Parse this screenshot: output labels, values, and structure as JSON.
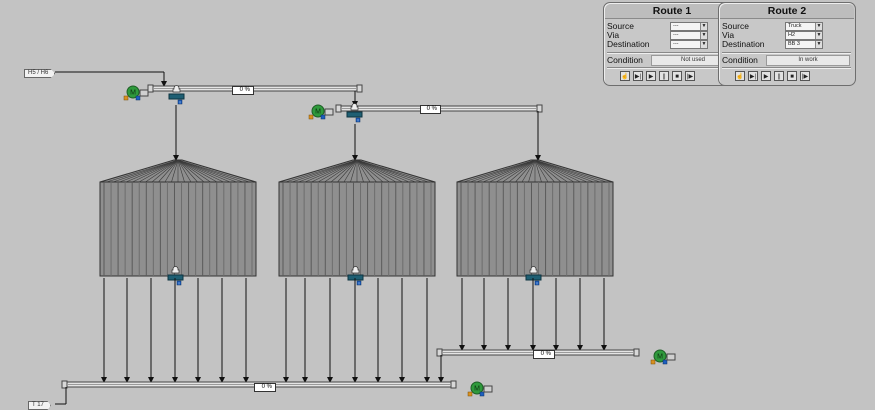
{
  "colors": {
    "background": "#c3c3c3",
    "silo_dark": "#6d6d6d",
    "silo_mid": "#8f8f8f",
    "motor_green": "#2f9a3c",
    "valve_teal": "#1f5f73",
    "info_blue": "#1d5fbf",
    "lock_orange": "#d99020"
  },
  "tags": {
    "intake": "H5 / H6",
    "outlet": "T 17"
  },
  "conveyors": {
    "top_1": {
      "value": "0",
      "unit": "%"
    },
    "top_2": {
      "value": "0",
      "unit": "%"
    },
    "bottom_right": {
      "value": "0",
      "unit": "%"
    },
    "bottom_main": {
      "value": "0",
      "unit": "%"
    }
  },
  "motor_symbol": "M",
  "info_symbol": "i",
  "routes": [
    {
      "title": "Route 1",
      "source_label": "Source",
      "source": "---",
      "via_label": "Via",
      "via": "---",
      "destination_label": "Destination",
      "destination": "---",
      "condition_label": "Condition",
      "condition": "Not used"
    },
    {
      "title": "Route 2",
      "source_label": "Source",
      "source": "Truck",
      "via_label": "Via",
      "via": "H2",
      "destination_label": "Destination",
      "destination": "BB 3",
      "condition_label": "Condition",
      "condition": "In work"
    }
  ],
  "route_buttons": [
    {
      "name": "hand-icon",
      "glyph": "☝"
    },
    {
      "name": "step-icon",
      "glyph": "▶|"
    },
    {
      "name": "play-icon",
      "glyph": "▶"
    },
    {
      "name": "pause-icon",
      "glyph": "||"
    },
    {
      "name": "stop-icon",
      "glyph": "■"
    },
    {
      "name": "skip-icon",
      "glyph": "|▶"
    }
  ]
}
